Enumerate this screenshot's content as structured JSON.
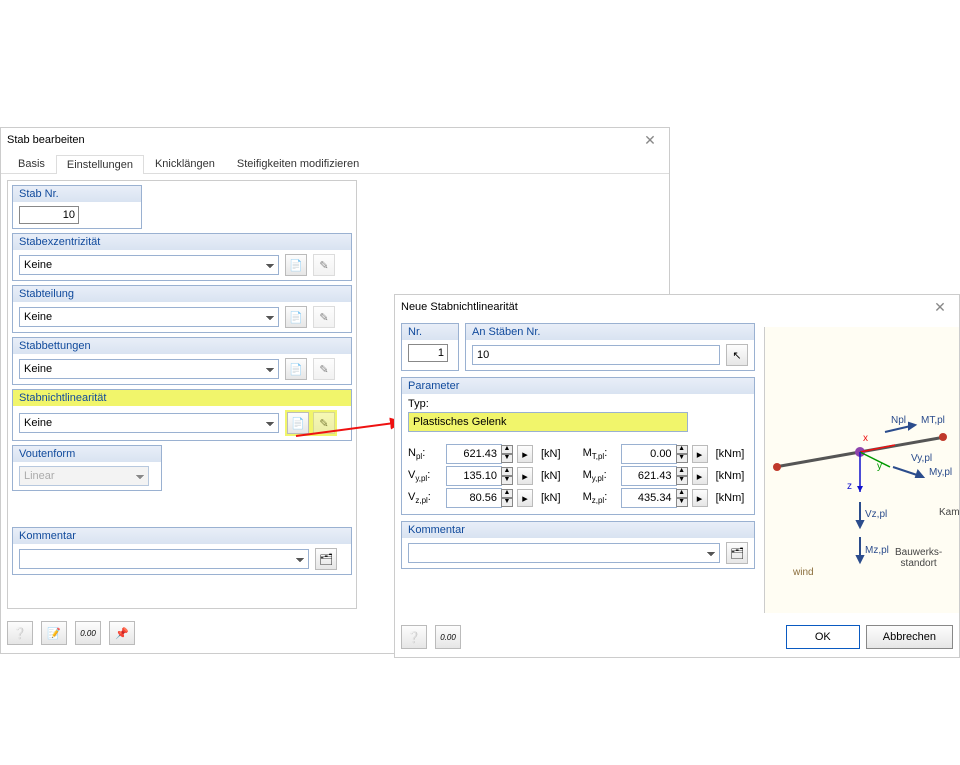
{
  "win1": {
    "title": "Stab bearbeiten",
    "tabs": [
      "Basis",
      "Einstellungen",
      "Knicklängen",
      "Steifigkeiten modifizieren"
    ],
    "stabnr_title": "Stab Nr.",
    "stabnr": "10",
    "exz_title": "Stabexzentrizität",
    "exz_val": "Keine",
    "teil_title": "Stabteilung",
    "teil_val": "Keine",
    "bet_title": "Stabbettungen",
    "bet_val": "Keine",
    "nl_title": "Stabnichtlinearität",
    "nl_val": "Keine",
    "vf_title": "Voutenform",
    "vf_val": "Linear",
    "komm_title": "Kommentar",
    "komm_val": ""
  },
  "win2": {
    "title": "Neue Stabnichtlinearität",
    "nr_title": "Nr.",
    "nr": "1",
    "staben_title": "An Stäben Nr.",
    "staben": "10",
    "param_title": "Parameter",
    "typ_label": "Typ:",
    "typ_val": "Plastisches Gelenk",
    "p": {
      "Npl": "621.43",
      "Vypl": "135.10",
      "Vzpl": "80.56",
      "MTpl": "0.00",
      "Mypl": "621.43",
      "Mzpl": "435.34",
      "kN": "[kN]",
      "kNm": "[kNm]",
      "l_Npl": "N",
      "l_Vypl": "V",
      "l_Vzpl": "V",
      "l_MTpl": "M",
      "l_Mypl": "M",
      "l_Mzpl": "M",
      "s_Npl": "pl",
      "s_Vypl": "y,pl",
      "s_Vzpl": "z,pl",
      "s_MTpl": "T,pl",
      "s_Mypl": "y,pl",
      "s_Mzpl": "z,pl"
    },
    "komm_title": "Kommentar",
    "komm_val": "",
    "ok": "OK",
    "cancel": "Abbrechen",
    "diag": {
      "Npl": "Npl",
      "MTpl": "MT,pl",
      "Vypl": "Vy,pl",
      "Mypl": "My,pl",
      "Vzpl": "Vz,pl",
      "Mzpl": "Mz,pl",
      "x": "x",
      "y": "y",
      "z": "z",
      "wind": "wind",
      "kamm": "Kamm",
      "loc": "Bauwerks-\nstandort"
    }
  }
}
